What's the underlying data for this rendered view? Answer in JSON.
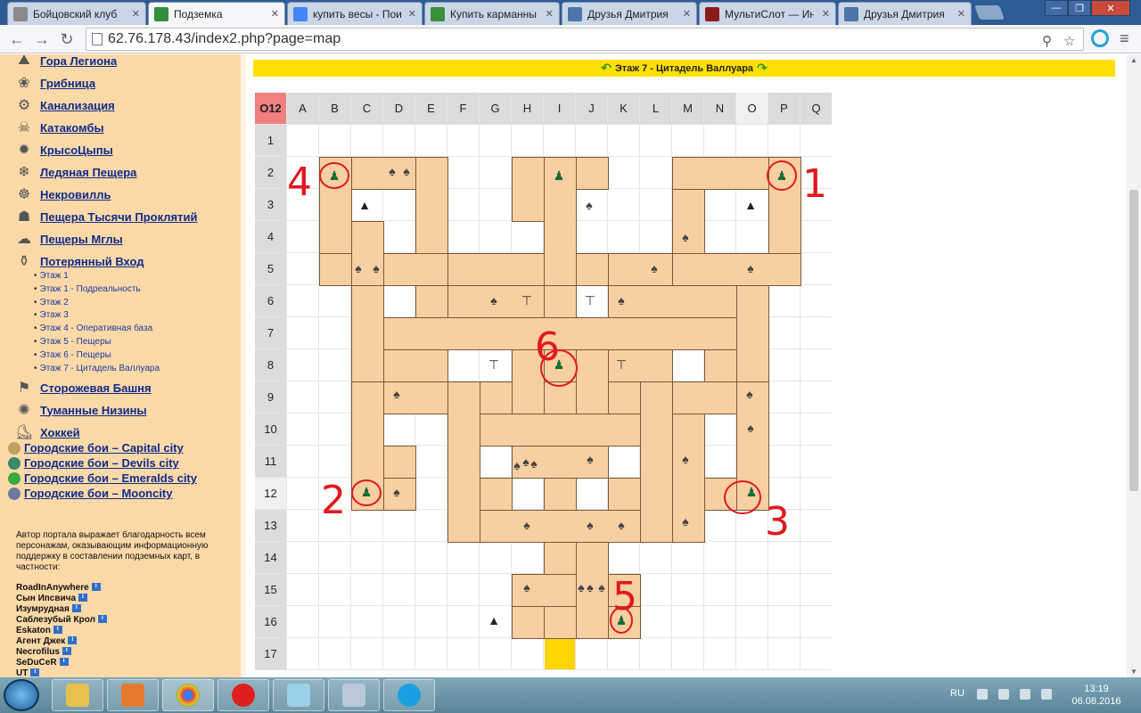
{
  "browser": {
    "tabs": [
      {
        "title": "Бойцовский клуб",
        "active": false,
        "color": "#8a8a8a"
      },
      {
        "title": "Подземка",
        "active": true,
        "color": "#2f8f3a"
      },
      {
        "title": "купить весы - Пои",
        "active": false,
        "color": "#4285f4"
      },
      {
        "title": "Купить карманны",
        "active": false,
        "color": "#3a8f3a"
      },
      {
        "title": "Друзья Дмитрия",
        "active": false,
        "color": "#4a76a8"
      },
      {
        "title": "МультиСлот — Ин",
        "active": false,
        "color": "#8b1a1a"
      },
      {
        "title": "Друзья Дмитрия",
        "active": false,
        "color": "#4a76a8"
      }
    ],
    "url": "62.76.178.43/index2.php?page=map"
  },
  "sidebar": {
    "locations": [
      "Гора Легиона",
      "Грибница",
      "Канализация",
      "Катакомбы",
      "КрысоЦыпы",
      "Ледяная Пещера",
      "Некровилль",
      "Пещера Тысячи Проклятий",
      "Пещеры Мглы",
      "Потерянный Вход"
    ],
    "floors": [
      "Этаж 1",
      "Этаж 1 - Подреальность",
      "Этаж 2",
      "Этаж 3",
      "Этаж 4 - Оперативная база",
      "Этаж 5 - Пещеры",
      "Этаж 6 - Пещеры",
      "Этаж 7 - Цитадель Валлуара"
    ],
    "locations2": [
      "Сторожевая Башня",
      "Туманные Низины",
      "Хоккей"
    ],
    "city_fights": [
      {
        "label": "Городские бои – Capital city",
        "color": "#c0a060"
      },
      {
        "label": "Городские бои – Devils city",
        "color": "#3a8a6a"
      },
      {
        "label": "Городские бои – Emeralds city",
        "color": "#3aaa3a"
      },
      {
        "label": "Городские бои – Mooncity",
        "color": "#6a7aa0"
      }
    ],
    "thanks_text": "Автор портала выражает благодарность всем персонажам, оказывающим информационную поддержку в составлении подземных карт, в частности:",
    "contributors": [
      "RoadInAnywhere",
      "Сын Ипсвича",
      "Изумрудная",
      "Саблезубый Крол",
      "Eskaton",
      "Агент Джек",
      "Necrofilus",
      "SeDuCeR",
      "UT"
    ]
  },
  "map": {
    "floor_title": "Этаж 7 - Цитадель Валлуара",
    "corner_label": "O12",
    "columns": [
      "A",
      "B",
      "C",
      "D",
      "E",
      "F",
      "G",
      "H",
      "I",
      "J",
      "K",
      "L",
      "M",
      "N",
      "O",
      "P",
      "Q"
    ],
    "rows": [
      "1",
      "2",
      "3",
      "4",
      "5",
      "6",
      "7",
      "8",
      "9",
      "10",
      "11",
      "12",
      "13",
      "14",
      "15",
      "16",
      "17"
    ],
    "highlight_column": "O",
    "highlight_row": "12",
    "annotations": [
      "4",
      "1",
      "6",
      "2",
      "3",
      "5"
    ]
  },
  "taskbar": {
    "lang": "RU",
    "time": "13:19",
    "date": "06.08.2016"
  }
}
